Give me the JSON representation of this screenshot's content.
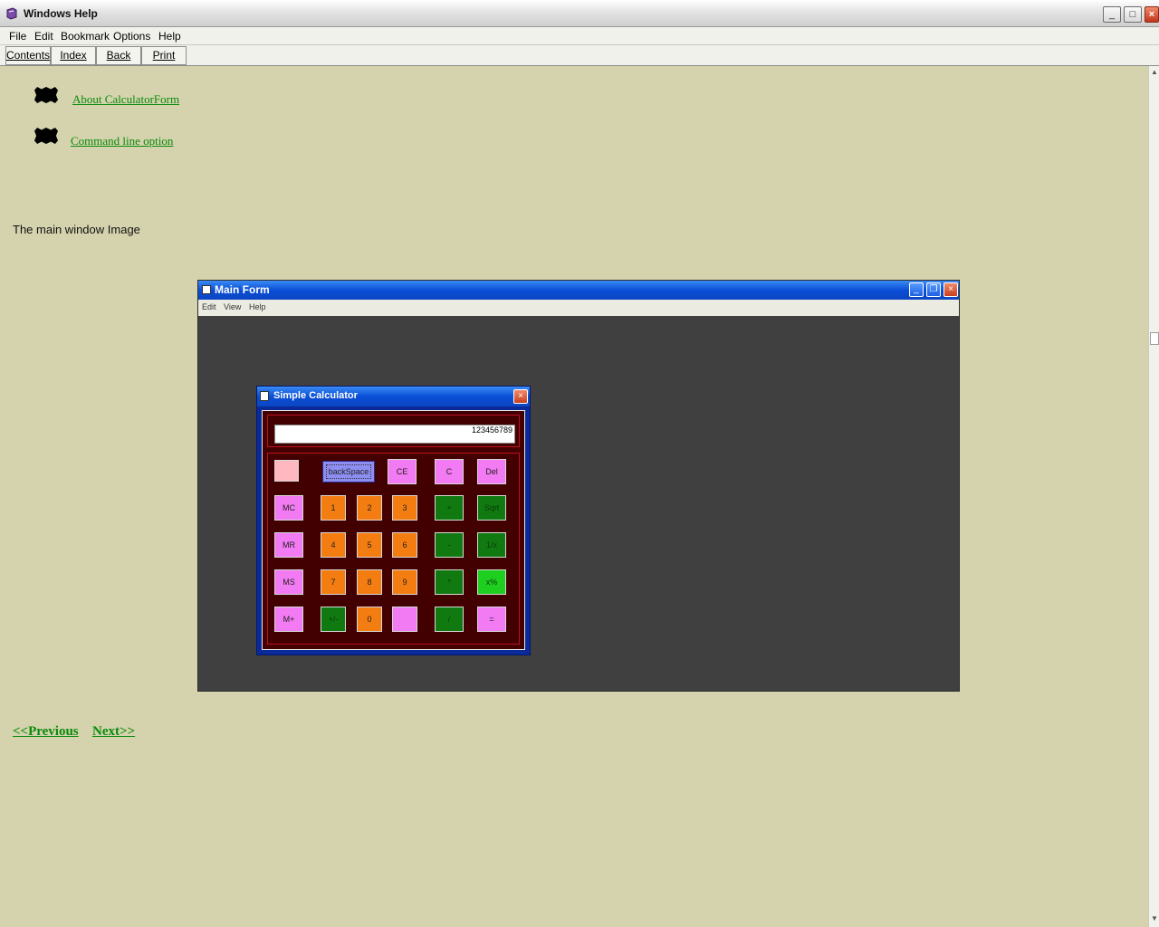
{
  "window": {
    "title": "Windows Help"
  },
  "menu": [
    "File",
    "Edit",
    "Bookmark",
    "Options",
    "Help"
  ],
  "toolbar": [
    "Contents",
    "Index",
    "Back",
    "Print"
  ],
  "links": [
    "About CalculatorForm",
    "Command line option"
  ],
  "caption": "The main window Image",
  "nav": {
    "previous": "<<Previous",
    "next": "Next>>"
  },
  "screenshot": {
    "main_form_title": "Main Form",
    "main_menu": [
      "Edit",
      "View",
      "Help"
    ],
    "calculator": {
      "title": "Simple Calculator",
      "display_value": "123456789",
      "keys": {
        "blank_top": "",
        "backspace": "backSpace",
        "ce": "CE",
        "c": "C",
        "del": "Del",
        "mc": "MC",
        "k1": "1",
        "k2": "2",
        "k3": "3",
        "plus": "+",
        "sqrt": "Sqrt",
        "mr": "MR",
        "k4": "4",
        "k5": "5",
        "k6": "6",
        "minus": "-",
        "recip": "1/x",
        "ms": "MS",
        "k7": "7",
        "k8": "8",
        "k9": "9",
        "mul": "*",
        "pct": "x%",
        "mplus": "M+",
        "sign": "+/-",
        "k0": "0",
        "dot": "",
        "div": "/",
        "eq": "="
      }
    }
  }
}
